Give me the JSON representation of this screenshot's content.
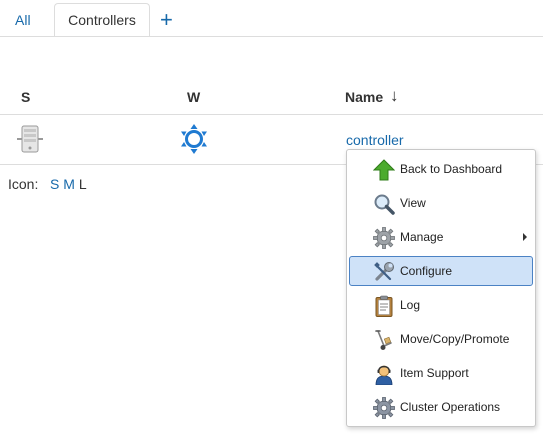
{
  "tabs": {
    "all": "All",
    "active": "Controllers",
    "add": "+"
  },
  "table": {
    "headers": {
      "s": "S",
      "w": "W",
      "name": "Name",
      "sort_indicator": "↓"
    },
    "rows": [
      {
        "name": "controller"
      }
    ]
  },
  "icon_size": {
    "label": "Icon:",
    "small": "S",
    "medium": "M",
    "large": "L"
  },
  "context_menu": {
    "items": [
      {
        "label": "Back to Dashboard",
        "icon": "up-arrow-icon"
      },
      {
        "label": "View",
        "icon": "magnifier-icon"
      },
      {
        "label": "Manage",
        "icon": "gear-icon",
        "has_submenu": true
      },
      {
        "label": "Configure",
        "icon": "wrench-icon",
        "selected": true
      },
      {
        "label": "Log",
        "icon": "clipboard-icon"
      },
      {
        "label": "Move/Copy/Promote",
        "icon": "hand-truck-icon"
      },
      {
        "label": "Item Support",
        "icon": "support-person-icon"
      },
      {
        "label": "Cluster Operations",
        "icon": "gear-icon"
      }
    ]
  },
  "colors": {
    "link": "#1769aa",
    "selected_bg": "#cfe2f8",
    "selected_border": "#4b82c4"
  }
}
